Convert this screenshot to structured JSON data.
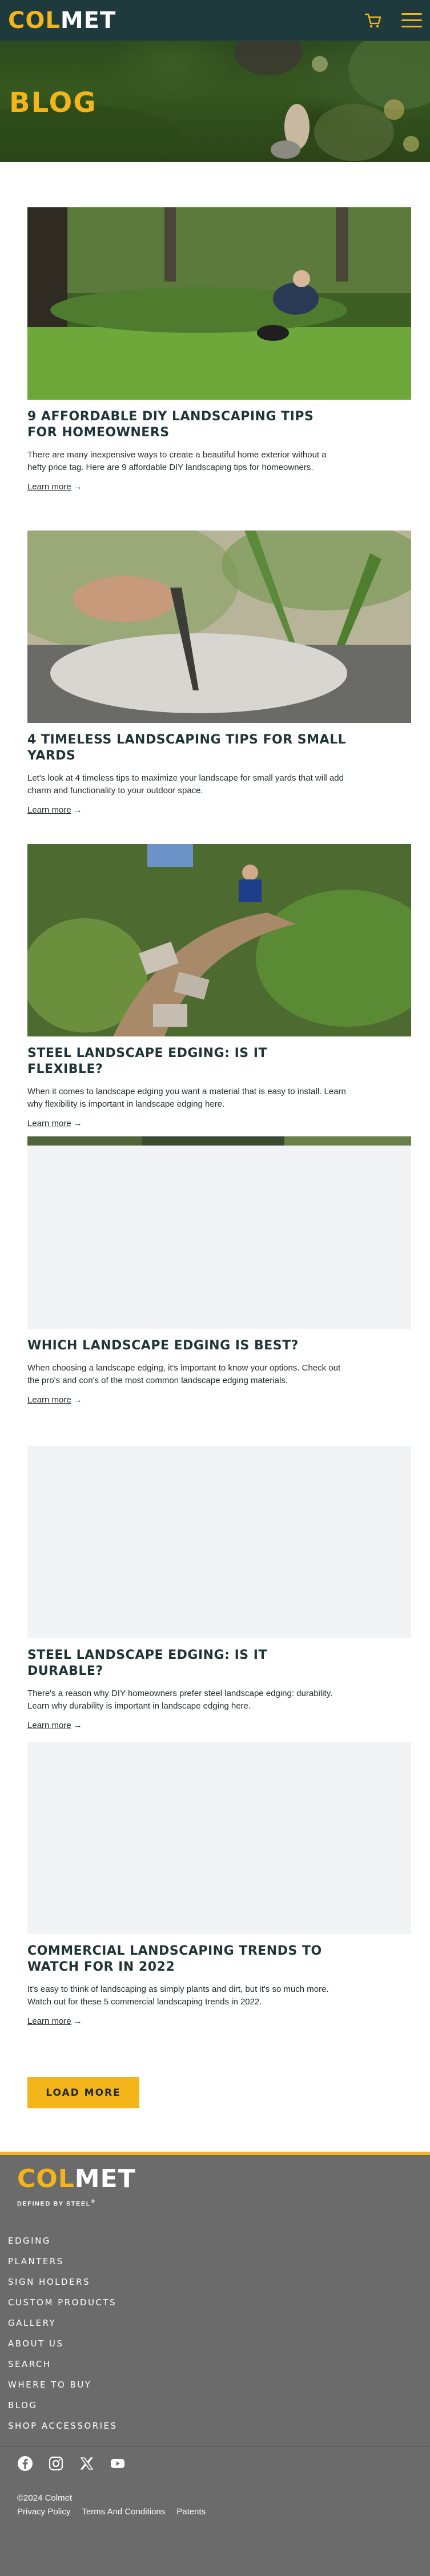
{
  "header": {
    "logo_text_yellow": "COL",
    "logo_text_white": "MET",
    "cart_icon": "cart-icon",
    "menu_icon": "hamburger-menu-icon"
  },
  "hero": {
    "title": "BLOG"
  },
  "posts": [
    {
      "title": "9 AFFORDABLE DIY LANDSCAPING TIPS FOR HOMEOWNERS",
      "excerpt": "There are many inexpensive ways to create a beautiful home exterior without a hefty price tag. Here are 9 affordable DIY landscaping tips for homeowners.",
      "link": "Learn more"
    },
    {
      "title": "4 TIMELESS LANDSCAPING TIPS FOR SMALL YARDS",
      "excerpt": "Let's look at 4 timeless tips to maximize your landscape for small yards that will add charm and functionality to your outdoor space.",
      "link": "Learn more"
    },
    {
      "title": "STEEL LANDSCAPE EDGING: IS IT FLEXIBLE?",
      "excerpt": "When it comes to landscape edging you want a material that is easy to install. Learn why flexibility is important in landscape edging here.",
      "link": "Learn more"
    },
    {
      "title": "WHICH LANDSCAPE EDGING IS BEST?",
      "excerpt": "When choosing a landscape edging, it's important to know your options. Check out the pro's and con's of the most common landscape edging materials.",
      "link": "Learn more"
    },
    {
      "title": "STEEL LANDSCAPE EDGING: IS IT DURABLE?",
      "excerpt": "There's a reason why DIY homeowners prefer steel landscape edging: durability. Learn why durability is important in landscape edging here.",
      "link": "Learn more"
    },
    {
      "title": "COMMERCIAL LANDSCAPING TRENDS TO WATCH FOR IN 2022",
      "excerpt": "It's easy to think of landscaping as simply plants and dirt, but it's so much more. Watch out for these 5 commercial landscaping trends in 2022.",
      "link": "Learn more"
    }
  ],
  "load_more": "LOAD MORE",
  "footer": {
    "logo_text_yellow": "COL",
    "logo_text_white": "MET",
    "tagline": "DEFINED BY STEEL",
    "tagline_mark": "®",
    "nav": [
      "EDGING",
      "PLANTERS",
      "SIGN HOLDERS",
      "CUSTOM PRODUCTS",
      "GALLERY",
      "ABOUT US",
      "SEARCH",
      "WHERE TO BUY",
      "BLOG",
      "SHOP ACCESSORIES"
    ],
    "social": [
      "facebook-icon",
      "instagram-icon",
      "x-twitter-icon",
      "youtube-icon"
    ],
    "copyright": "©2024 Colmet",
    "legal": [
      "Privacy Policy",
      "Terms And Conditions",
      "Patents"
    ]
  },
  "colors": {
    "brand_yellow": "#f4b51b",
    "header_bg": "#1e3a3c",
    "footer_bg": "#6b6b6b",
    "title_dark": "#1f3436"
  }
}
